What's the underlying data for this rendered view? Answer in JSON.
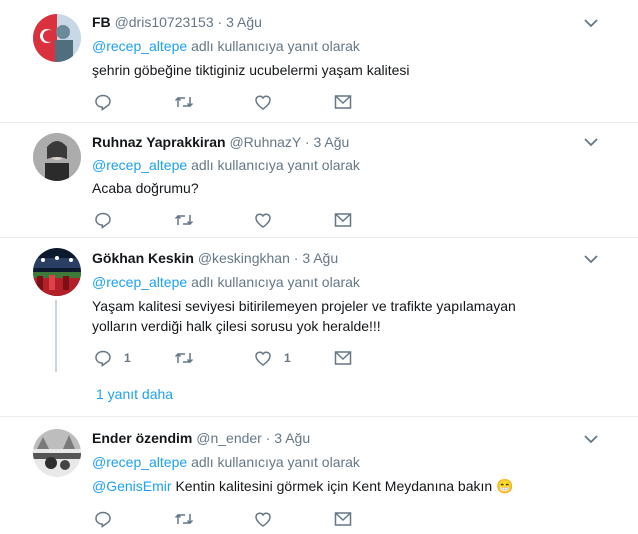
{
  "reply_prefix": "adlı kullanıcıya yanıt olarak",
  "tweets": [
    {
      "name": "FB",
      "handle": "@dris10723153",
      "time": "3 Ağu",
      "reply_to": "@recep_altepe",
      "text": "şehrin göbeğine tiktiginiz ucubelermi yaşam kalitesi",
      "reply_count": "",
      "like_count": ""
    },
    {
      "name": "Ruhnaz Yaprakkiran",
      "handle": "@RuhnazY",
      "time": "3 Ağu",
      "reply_to": "@recep_altepe",
      "text": "Acaba doğrumu?",
      "reply_count": "",
      "like_count": ""
    },
    {
      "name": "Gökhan Keskin",
      "handle": "@keskingkhan",
      "time": "3 Ağu",
      "reply_to": "@recep_altepe",
      "text": "Yaşam kalitesi seviyesi bitirilemeyen projeler ve trafikte yapılamayan yolların verdiği halk çilesi sorusu yok heralde!!!",
      "reply_count": "1",
      "like_count": "1",
      "more_replies": "1 yanıt daha"
    },
    {
      "name": "Ender özendim",
      "handle": "@n_ender",
      "time": "3 Ağu",
      "reply_to": "@recep_altepe",
      "mention": "@GenisEmir",
      "text": "Kentin kalitesini görmek için Kent Meydanına bakın",
      "emoji": "😁",
      "reply_count": "",
      "like_count": ""
    }
  ],
  "colors": {
    "link": "#1da1f2",
    "meta": "#657786",
    "separator": "#e6ecf0"
  },
  "icons": [
    "reply-icon",
    "retweet-icon",
    "like-icon",
    "dm-icon",
    "chevron-down-icon"
  ]
}
